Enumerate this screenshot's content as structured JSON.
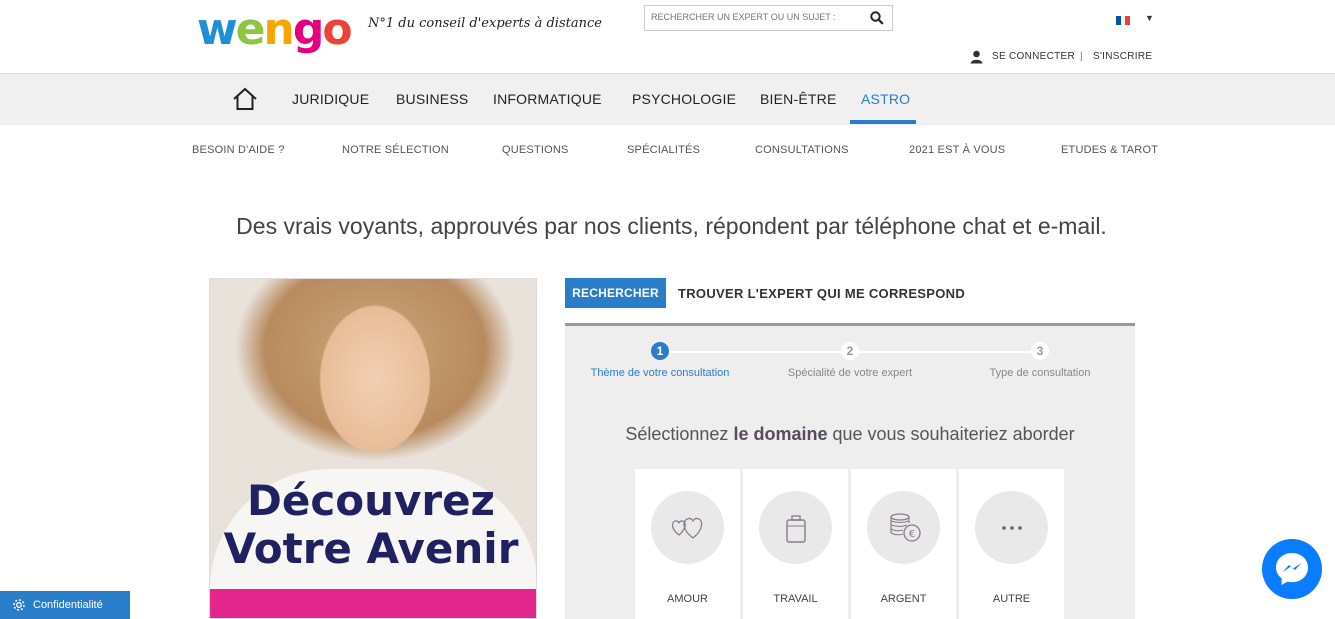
{
  "header": {
    "logo": {
      "w": "w",
      "e": "e",
      "n": "n",
      "g": "g",
      "o": "o"
    },
    "tagline": "N°1 du conseil d'experts à distance",
    "search_placeholder": "RECHERCHER UN EXPERT OU UN SUJET :",
    "login": "SE CONNECTER",
    "separator": "|",
    "signup": "S'INSCRIRE",
    "flag_colors": [
      "#0055a4",
      "#ffffff",
      "#ef4135"
    ]
  },
  "nav": {
    "items": [
      "JURIDIQUE",
      "BUSINESS",
      "INFORMATIQUE",
      "PSYCHOLOGIE",
      "BIEN-ÊTRE",
      "ASTRO"
    ],
    "active": "ASTRO"
  },
  "subnav": [
    "BESOIN D'AIDE ?",
    "NOTRE SÉLECTION",
    "QUESTIONS",
    "SPÉCIALITÉS",
    "CONSULTATIONS",
    "2021 EST À VOUS",
    "ETUDES & TAROT"
  ],
  "headline": "Des vrais voyants, approuvés par nos clients, répondent par téléphone chat et e-mail.",
  "promo": {
    "line1": "Découvrez",
    "line2": "Votre Avenir"
  },
  "finder": {
    "search_button": "RECHERCHER",
    "title": "TROUVER L'EXPERT QUI ME CORRESPOND",
    "steps": [
      {
        "num": "1",
        "label": "Thème de votre consultation"
      },
      {
        "num": "2",
        "label": "Spécialité de votre expert"
      },
      {
        "num": "3",
        "label": "Type de consultation"
      }
    ],
    "prompt_pre": "Sélectionnez ",
    "prompt_bold": "le domaine",
    "prompt_post": " que vous souhaiteriez aborder",
    "categories": [
      "AMOUR",
      "TRAVAIL",
      "ARGENT",
      "AUTRE"
    ]
  },
  "privacy": "Confidentialité",
  "colors": {
    "accent": "#2a7dc9",
    "promo_band": "#e2268c",
    "promo_title": "#1f2160"
  }
}
